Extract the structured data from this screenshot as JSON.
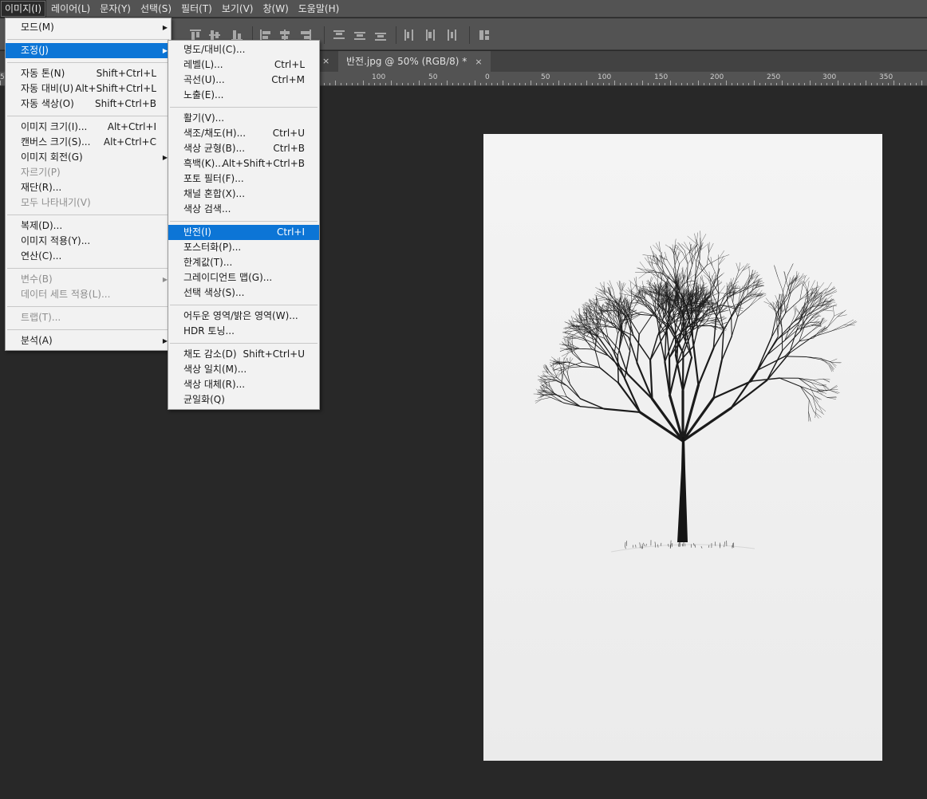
{
  "menubar": {
    "items": [
      "이미지(I)",
      "레이어(L)",
      "문자(Y)",
      "선택(S)",
      "필터(T)",
      "보기(V)",
      "창(W)",
      "도움말(H)"
    ]
  },
  "tabs": {
    "active_label": "반전.jpg @ 50% (RGB/8) *",
    "close_glyph": "×"
  },
  "ruler": {
    "labels": [
      "50",
      "100",
      "50",
      "0",
      "50",
      "100",
      "150",
      "200",
      "250",
      "300",
      "350"
    ]
  },
  "image_menu": {
    "items": [
      {
        "label": "모드(M)",
        "shortcut": "",
        "submenu": true
      },
      {
        "label": "조정(J)",
        "shortcut": "",
        "submenu": true
      },
      {
        "label": "자동 톤(N)",
        "shortcut": "Shift+Ctrl+L"
      },
      {
        "label": "자동 대비(U)",
        "shortcut": "Alt+Shift+Ctrl+L"
      },
      {
        "label": "자동 색상(O)",
        "shortcut": "Shift+Ctrl+B"
      },
      {
        "label": "이미지 크기(I)...",
        "shortcut": "Alt+Ctrl+I"
      },
      {
        "label": "캔버스 크기(S)...",
        "shortcut": "Alt+Ctrl+C"
      },
      {
        "label": "이미지 회전(G)",
        "shortcut": "",
        "submenu": true
      },
      {
        "label": "자르기(P)",
        "shortcut": "",
        "disabled": true
      },
      {
        "label": "재단(R)...",
        "shortcut": ""
      },
      {
        "label": "모두 나타내기(V)",
        "shortcut": "",
        "disabled": true
      },
      {
        "label": "복제(D)...",
        "shortcut": ""
      },
      {
        "label": "이미지 적용(Y)...",
        "shortcut": ""
      },
      {
        "label": "연산(C)...",
        "shortcut": ""
      },
      {
        "label": "변수(B)",
        "shortcut": "",
        "submenu": true,
        "disabled": true
      },
      {
        "label": "데이터 세트 적용(L)...",
        "shortcut": "",
        "disabled": true
      },
      {
        "label": "트랩(T)...",
        "shortcut": "",
        "disabled": true
      },
      {
        "label": "분석(A)",
        "shortcut": "",
        "submenu": true
      }
    ]
  },
  "adjust_menu": {
    "items": [
      {
        "label": "명도/대비(C)...",
        "shortcut": ""
      },
      {
        "label": "레벨(L)...",
        "shortcut": "Ctrl+L"
      },
      {
        "label": "곡선(U)...",
        "shortcut": "Ctrl+M"
      },
      {
        "label": "노출(E)...",
        "shortcut": ""
      },
      {
        "label": "활기(V)...",
        "shortcut": ""
      },
      {
        "label": "색조/채도(H)...",
        "shortcut": "Ctrl+U"
      },
      {
        "label": "색상 균형(B)...",
        "shortcut": "Ctrl+B"
      },
      {
        "label": "흑백(K)...",
        "shortcut": "Alt+Shift+Ctrl+B"
      },
      {
        "label": "포토 필터(F)...",
        "shortcut": ""
      },
      {
        "label": "채널 혼합(X)...",
        "shortcut": ""
      },
      {
        "label": "색상 검색...",
        "shortcut": ""
      },
      {
        "label": "반전(I)",
        "shortcut": "Ctrl+I"
      },
      {
        "label": "포스터화(P)...",
        "shortcut": ""
      },
      {
        "label": "한계값(T)...",
        "shortcut": ""
      },
      {
        "label": "그레이디언트 맵(G)...",
        "shortcut": ""
      },
      {
        "label": "선택 색상(S)...",
        "shortcut": ""
      },
      {
        "label": "어두운 영역/밝은 영역(W)...",
        "shortcut": ""
      },
      {
        "label": "HDR 토닝...",
        "shortcut": ""
      },
      {
        "label": "채도 감소(D)",
        "shortcut": "Shift+Ctrl+U"
      },
      {
        "label": "색상 일치(M)...",
        "shortcut": ""
      },
      {
        "label": "색상 대체(R)...",
        "shortcut": ""
      },
      {
        "label": "균일화(Q)",
        "shortcut": ""
      }
    ]
  },
  "colors": {
    "menu_highlight": "#0c75d6",
    "app_background": "#282828",
    "panel_gray": "#535353"
  },
  "canvas": {
    "content": "tree-in-snow-photo"
  }
}
